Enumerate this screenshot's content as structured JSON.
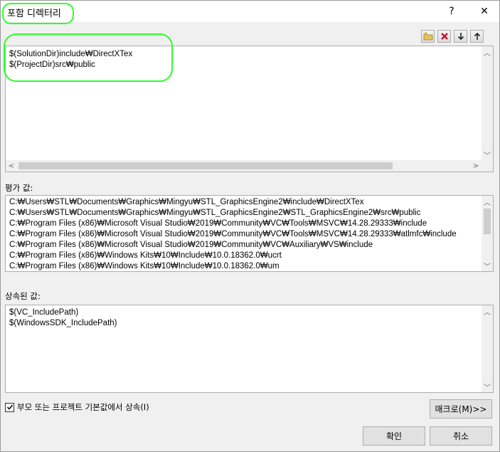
{
  "window": {
    "title": "포함 디렉터리",
    "help": "?",
    "close": "✕"
  },
  "toolbar": {
    "new_line_icon": "folder-new-icon",
    "delete_icon": "delete-icon",
    "down_icon": "arrow-down-icon",
    "up_icon": "arrow-up-icon"
  },
  "edit": {
    "lines": [
      "$(SolutionDir)include₩DirectXTex",
      "$(ProjectDir)src₩public"
    ]
  },
  "evaluated": {
    "label": "평가 값:",
    "lines": [
      "C:₩Users₩STL₩Documents₩Graphics₩Mingyu₩STL_GraphicsEngine2₩include₩DirectXTex",
      "C:₩Users₩STL₩Documents₩Graphics₩Mingyu₩STL_GraphicsEngine2₩STL_GraphicsEngine2₩src₩public",
      "C:₩Program Files (x86)₩Microsoft Visual Studio₩2019₩Community₩VC₩Tools₩MSVC₩14.28.29333₩include",
      "C:₩Program Files (x86)₩Microsoft Visual Studio₩2019₩Community₩VC₩Tools₩MSVC₩14.28.29333₩atlmfc₩include",
      "C:₩Program Files (x86)₩Microsoft Visual Studio₩2019₩Community₩VC₩Auxiliary₩VS₩include",
      "C:₩Program Files (x86)₩Windows Kits₩10₩Include₩10.0.18362.0₩ucrt",
      "C:₩Program Files (x86)₩Windows Kits₩10₩Include₩10.0.18362.0₩um"
    ]
  },
  "inherited": {
    "label": "상속된 값:",
    "lines": [
      "$(VC_IncludePath)",
      "$(WindowsSDK_IncludePath)"
    ]
  },
  "inherit_checkbox": {
    "label": "부모 또는 프로젝트 기본값에서 상속(I)",
    "checked": true
  },
  "buttons": {
    "macro": "매크로(M)>>",
    "ok": "확인",
    "cancel": "취소"
  },
  "colors": {
    "annotation": "#2bff2b"
  }
}
